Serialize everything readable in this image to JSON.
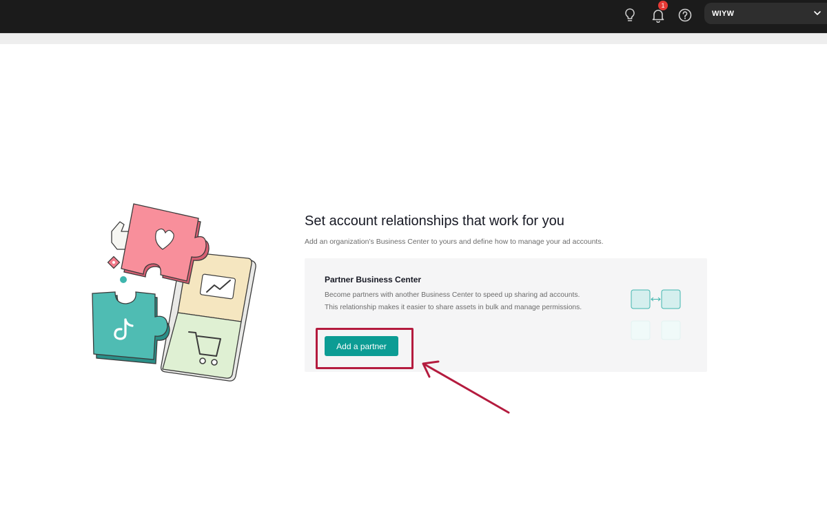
{
  "topbar": {
    "notifications_count": "1",
    "account_name": "WIYW",
    "icons": [
      "lightbulb-icon",
      "bell-icon",
      "help-icon",
      "chevron-down-icon"
    ]
  },
  "main": {
    "title": "Set account relationships that work for you",
    "subtitle": "Add an organization’s Business Center to yours and define how to manage your ad accounts."
  },
  "card": {
    "title": "Partner Business Center",
    "description": "Become partners with another Business Center to speed up sharing ad accounts. This relationship makes it easier to share assets in bulk and manage permissions.",
    "button_label": "Add a partner"
  },
  "colors": {
    "accent": "#0c9c94",
    "annotation": "#b41b3e",
    "topbar": "#1b1b1b",
    "badge": "#e53935"
  }
}
